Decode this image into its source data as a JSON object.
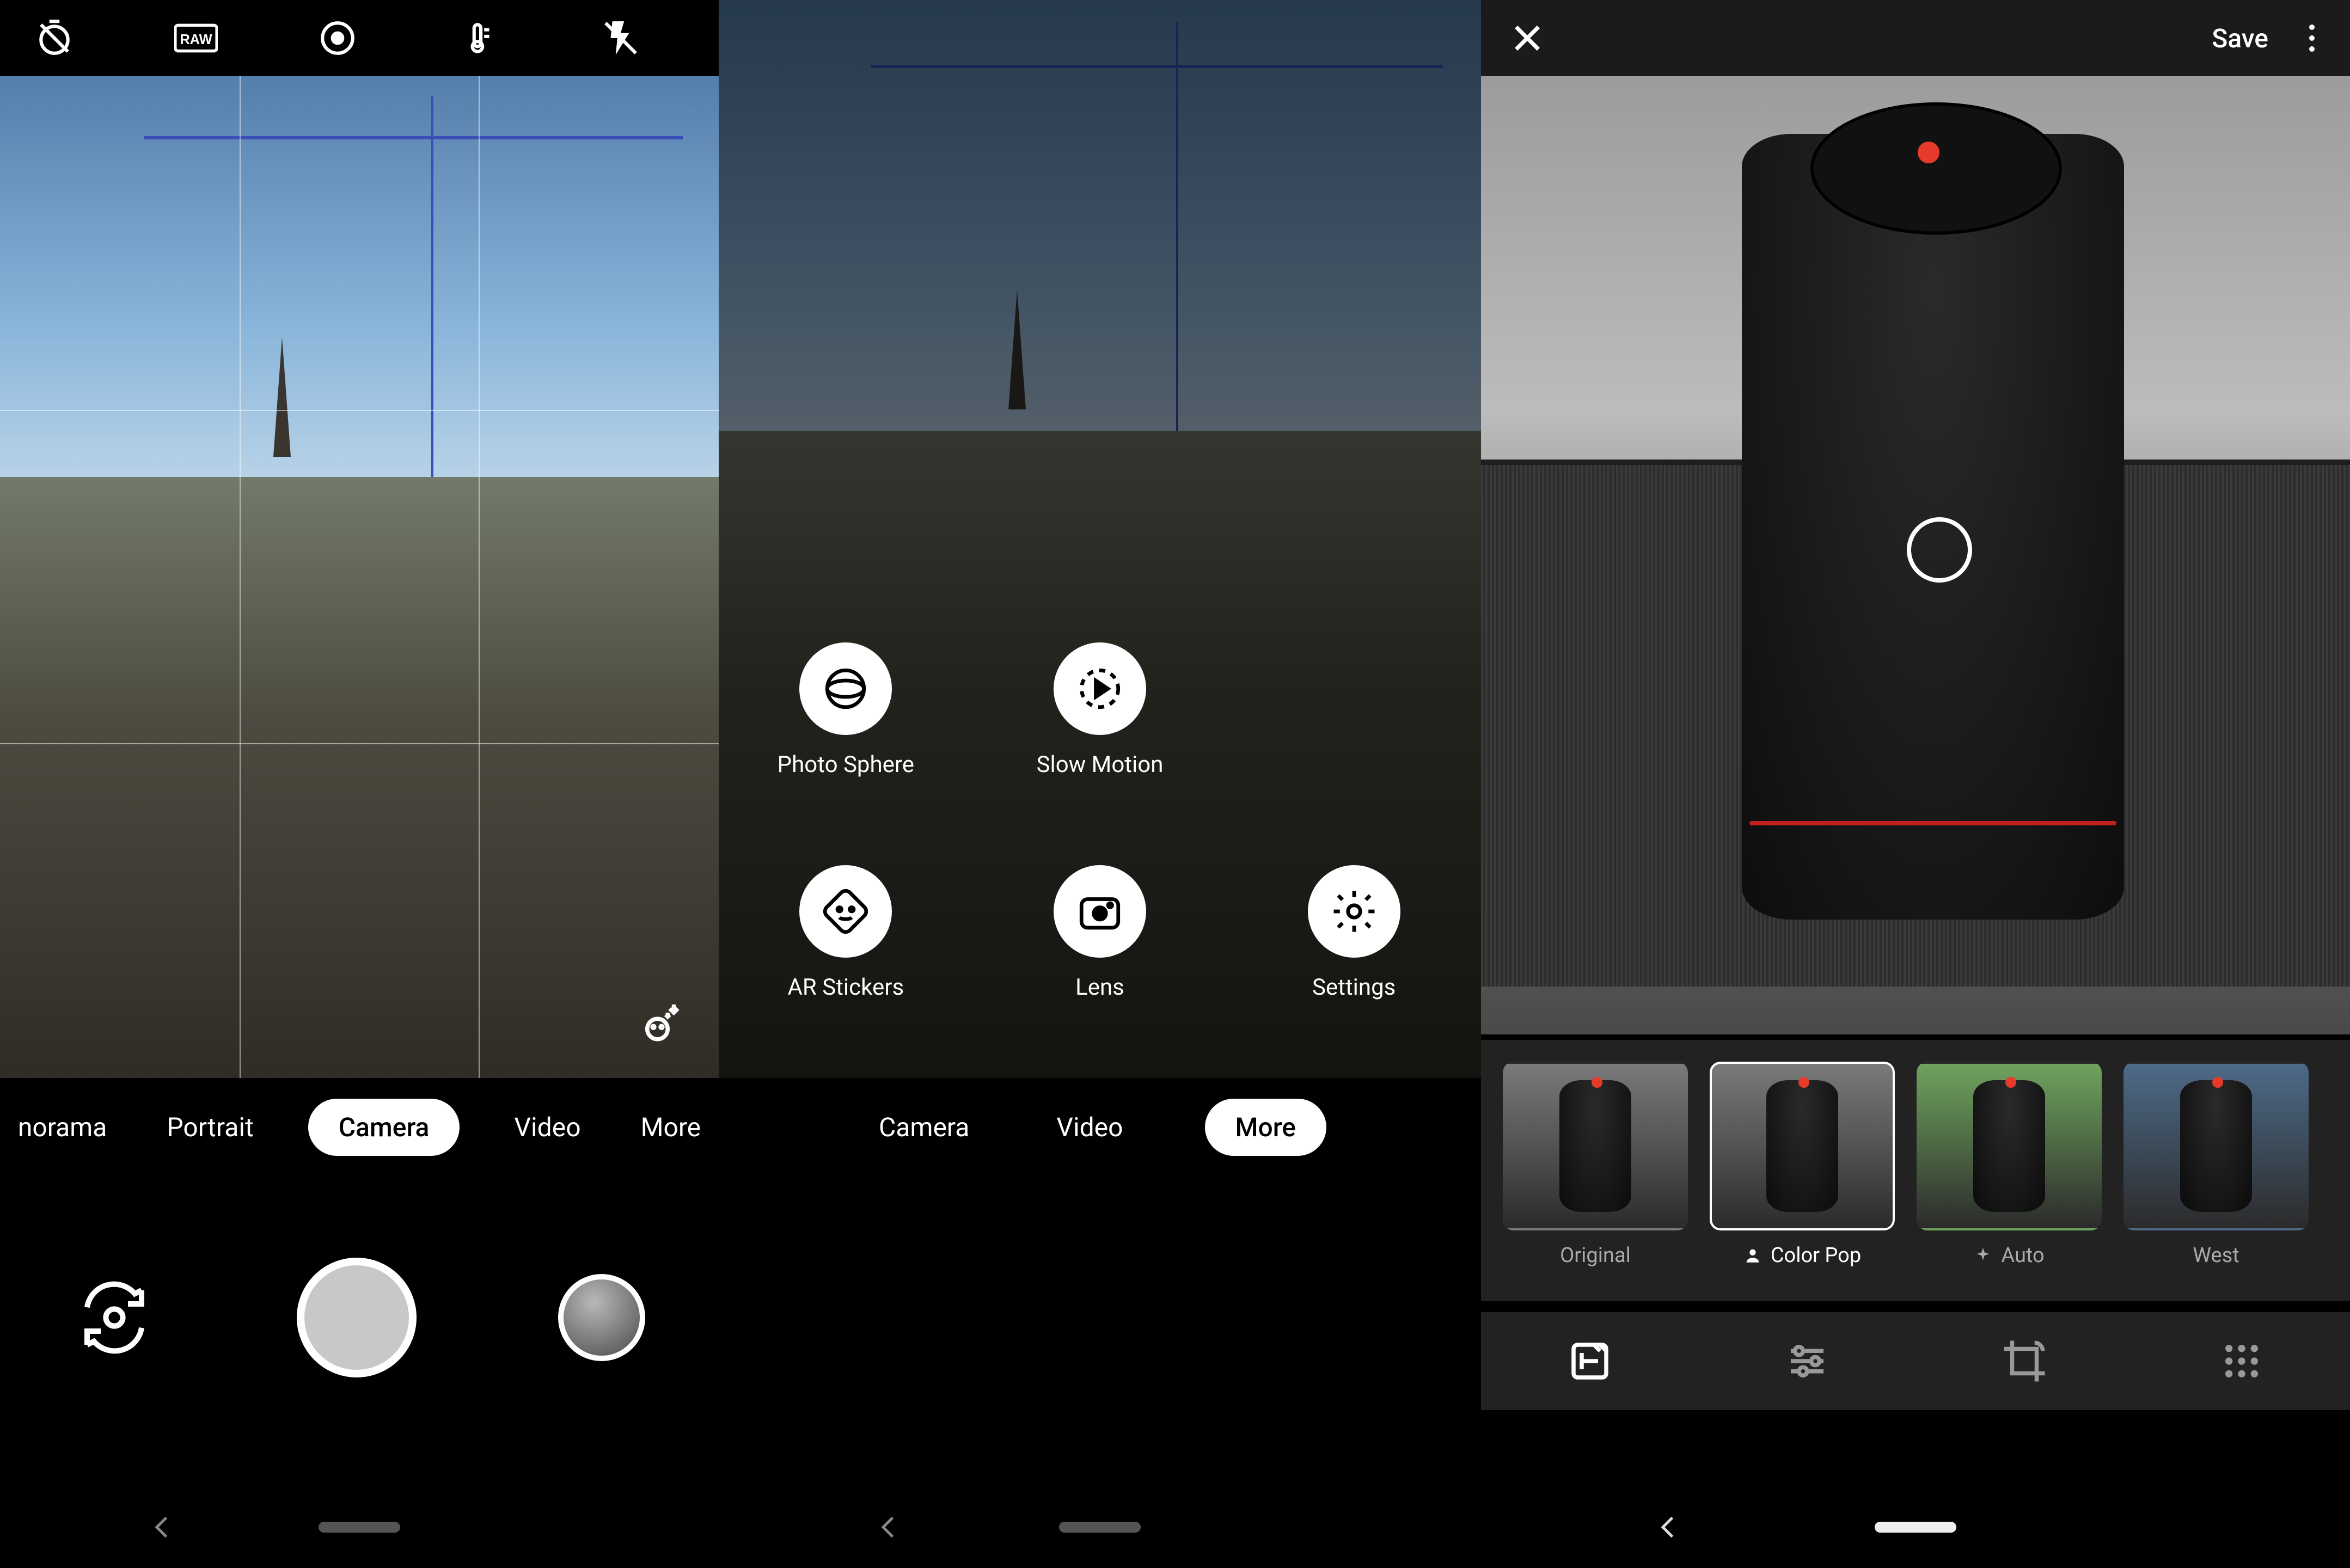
{
  "panel1": {
    "topbar_icons": [
      "timer-off-icon",
      "raw-icon",
      "motion-photo-icon",
      "white-balance-icon",
      "flash-off-icon"
    ],
    "modes": {
      "items": [
        "norama",
        "Portrait",
        "Camera",
        "Video",
        "More"
      ],
      "active": "Camera"
    }
  },
  "panel2": {
    "more_items": [
      {
        "id": "photo-sphere",
        "label": "Photo Sphere"
      },
      {
        "id": "slow-motion",
        "label": "Slow Motion"
      },
      {
        "id": "ar-stickers",
        "label": "AR Stickers"
      },
      {
        "id": "lens",
        "label": "Lens"
      },
      {
        "id": "settings",
        "label": "Settings"
      }
    ],
    "modes": {
      "items": [
        "Camera",
        "Video",
        "More"
      ],
      "active": "More"
    }
  },
  "panel3": {
    "header": {
      "save": "Save"
    },
    "filters": [
      {
        "id": "original",
        "label": "Original",
        "active": false
      },
      {
        "id": "color-pop",
        "label": "Color Pop",
        "active": true,
        "icon": "person"
      },
      {
        "id": "auto",
        "label": "Auto",
        "active": false,
        "icon": "sparkle"
      },
      {
        "id": "west",
        "label": "West",
        "active": false
      }
    ],
    "tabs": [
      "filters-tab",
      "adjust-tab",
      "crop-tab",
      "markup-tab"
    ]
  }
}
